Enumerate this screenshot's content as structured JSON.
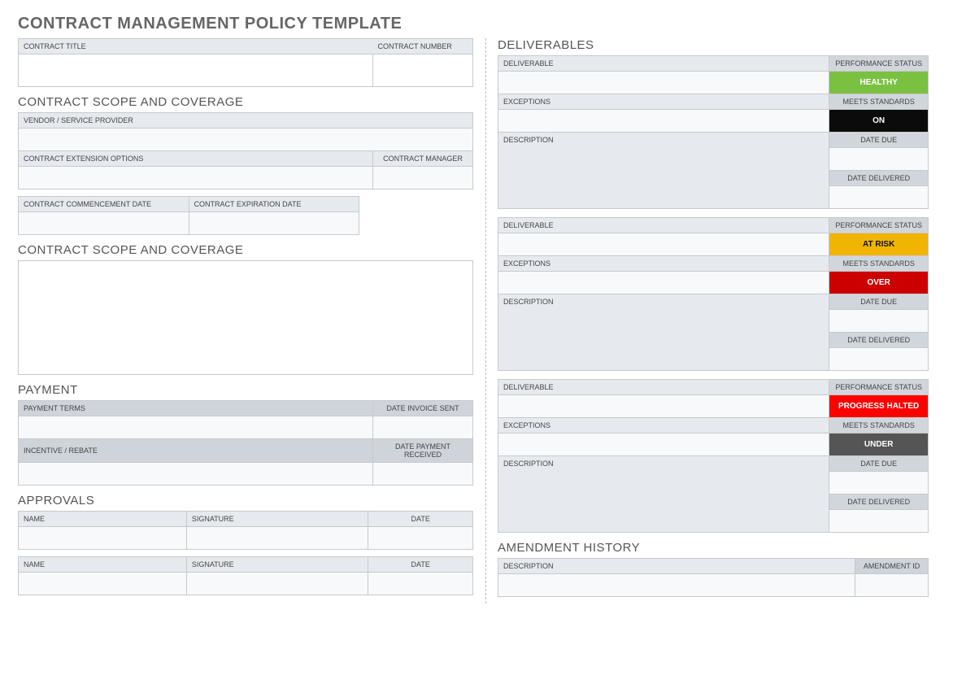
{
  "title": "CONTRACT MANAGEMENT POLICY TEMPLATE",
  "left": {
    "contract_title_label": "CONTRACT TITLE",
    "contract_number_label": "CONTRACT NUMBER",
    "scope_heading": "CONTRACT SCOPE AND COVERAGE",
    "vendor_label": "VENDOR / SERVICE PROVIDER",
    "ext_options_label": "CONTRACT EXTENSION OPTIONS",
    "manager_label": "CONTRACT MANAGER",
    "commence_label": "CONTRACT COMMENCEMENT DATE",
    "expire_label": "CONTRACT EXPIRATION DATE",
    "scope2_heading": "CONTRACT SCOPE AND COVERAGE",
    "payment_heading": "PAYMENT",
    "terms_label": "PAYMENT TERMS",
    "invoice_label": "DATE INVOICE SENT",
    "incentive_label": "INCENTIVE / REBATE",
    "received_label": "DATE PAYMENT RECEIVED",
    "approvals_heading": "APPROVALS",
    "name_label": "NAME",
    "signature_label": "SIGNATURE",
    "date_label": "DATE"
  },
  "right": {
    "deliverables_heading": "DELIVERABLES",
    "deliverable_label": "DELIVERABLE",
    "perf_status_label": "PERFORMANCE STATUS",
    "exceptions_label": "EXCEPTIONS",
    "meets_label": "MEETS STANDARDS",
    "description_label": "DESCRIPTION",
    "date_due_label": "DATE DUE",
    "date_delivered_label": "DATE DELIVERED",
    "status1": "HEALTHY",
    "standards1": "ON",
    "status2": "AT RISK",
    "standards2": "OVER",
    "status3": "PROGRESS HALTED",
    "standards3": "UNDER",
    "amend_heading": "AMENDMENT HISTORY",
    "amend_desc_label": "DESCRIPTION",
    "amend_id_label": "AMENDMENT ID"
  }
}
